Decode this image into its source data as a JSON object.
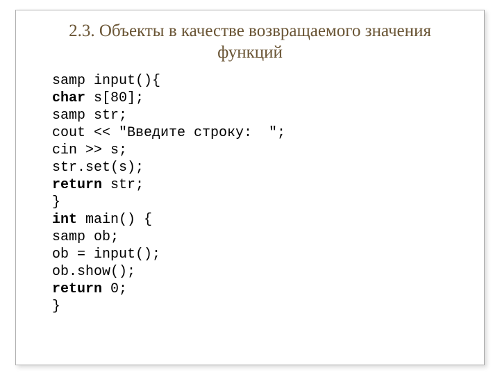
{
  "title": "2.3. Объекты в качестве возвращаемого значения функций",
  "code": {
    "l1a": "samp input(){",
    "l2a": "char",
    "l2b": " s[80];",
    "l3a": "samp str;",
    "l4a": "cout << \"Введите строку:  \";",
    "l5a": "cin >> s;",
    "l6a": "str.set(s);",
    "l7a": "return",
    "l7b": " str;",
    "l8a": "}",
    "l9a": "",
    "l10a": "int",
    "l10b": " main() {",
    "l11a": "samp ob;",
    "l12a": "ob = input();",
    "l13a": "ob.show();",
    "l14a": "return",
    "l14b": " 0;",
    "l15a": "}"
  }
}
